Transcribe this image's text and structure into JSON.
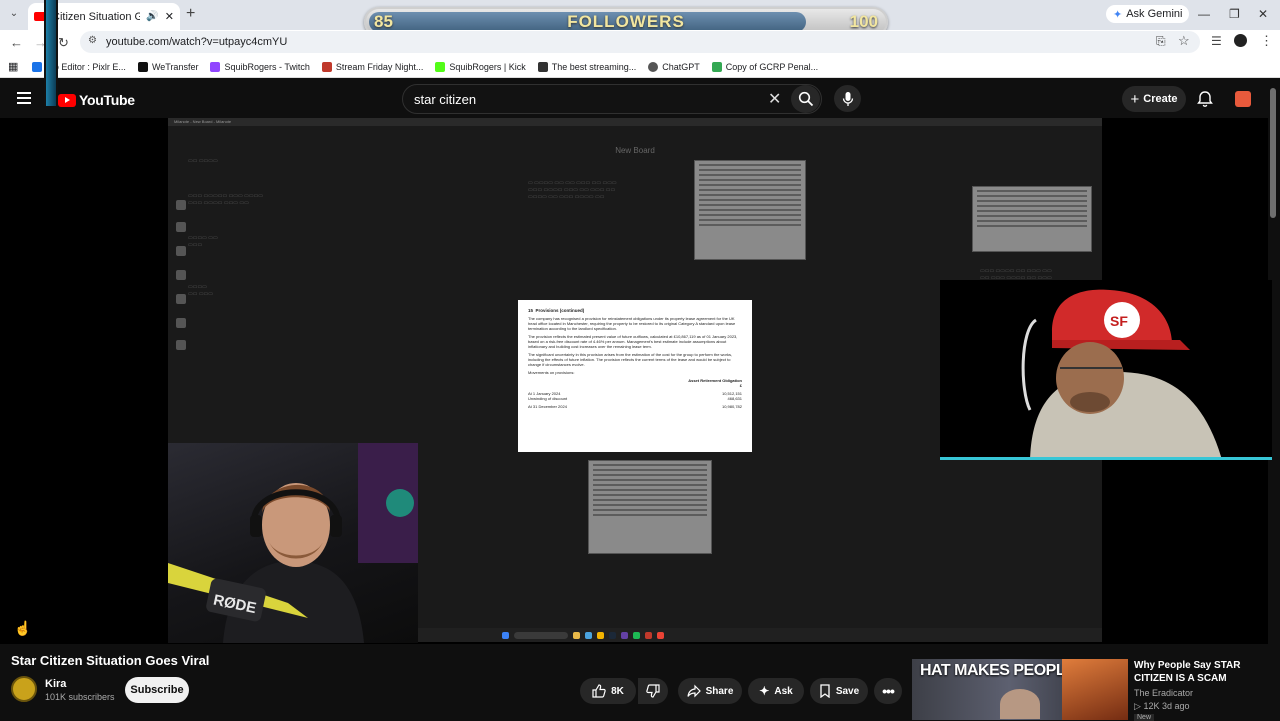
{
  "browser": {
    "tab_title": "Citizen Situation Goes",
    "url": "youtube.com/watch?v=utpayc4cmYU",
    "ask_gemini": "Ask Gemini",
    "bookmarks": [
      {
        "label": "oto Editor : Pixlr E...",
        "color": "#1a73e8"
      },
      {
        "label": "WeTransfer",
        "color": "#111111"
      },
      {
        "label": "SquibRogers - Twitch",
        "color": "#9146ff"
      },
      {
        "label": "Stream Friday Night...",
        "color": "#c0392b"
      },
      {
        "label": "SquibRogers | Kick",
        "color": "#53fc18"
      },
      {
        "label": "The best streaming...",
        "color": "#333333"
      },
      {
        "label": "ChatGPT",
        "color": "#555555"
      },
      {
        "label": "Copy of GCRP Penal...",
        "color": "#34a853"
      }
    ]
  },
  "overlay": {
    "followers_current": "85",
    "followers_label": "FOLLOWERS",
    "followers_goal": "100",
    "progress_fraction": 0.85
  },
  "youtube": {
    "logo_text": "YouTube",
    "search_query": "star citizen",
    "create_label": "Create"
  },
  "screen": {
    "app_title": "Milanote - New Board - Milanote",
    "board_title": "New Board",
    "doc": {
      "heading_num": "15",
      "heading": "Provisions (continued)",
      "p1": "The company has recognised a provision for reinstatement obligations under its property lease agreement for the UK head office located in Manchester, requiring the property to be restored to its original Category A standard upon lease termination according to the landlord specification.",
      "p2": "The provision reflects the estimated present value of future outflows, calculated at £10,867,119 as of 01 January 2023, based on a risk-free discount rate of 4.46% per annum. Management's best estimate include assumptions about inflationary and building cost increases over the remaining lease term.",
      "p3": "The significant uncertainty in this provision arises from the estimation of the cost for the group to perform the works, including the effects of future inflation. The provision reflects the current terms of the lease and would be subject to change if circumstances evolve.",
      "p4": "Movements on provisions:",
      "col_head": "Asset Retirement Obligation £",
      "row1_label": "At 1 January 2024",
      "row1_val": "10,512,151",
      "row2_label": "Unwinding of discount",
      "row2_val": "468,631",
      "row3_label": "At 31 December 2024",
      "row3_val": "10,980,782"
    }
  },
  "video": {
    "title": "Star Citizen Situation Goes Viral",
    "channel": "Kira",
    "subscribers": "101K subscribers",
    "subscribe": "Subscribe",
    "likes": "8K",
    "share": "Share",
    "ask": "Ask",
    "save": "Save"
  },
  "recommended": {
    "thumb_caption": "HAT MAKES PEOPLE SAY",
    "title": "Why People Say STAR CITIZEN IS A SCAM",
    "channel": "The Eradicator",
    "views": "12K",
    "age": "3d ago",
    "badge": "New"
  }
}
